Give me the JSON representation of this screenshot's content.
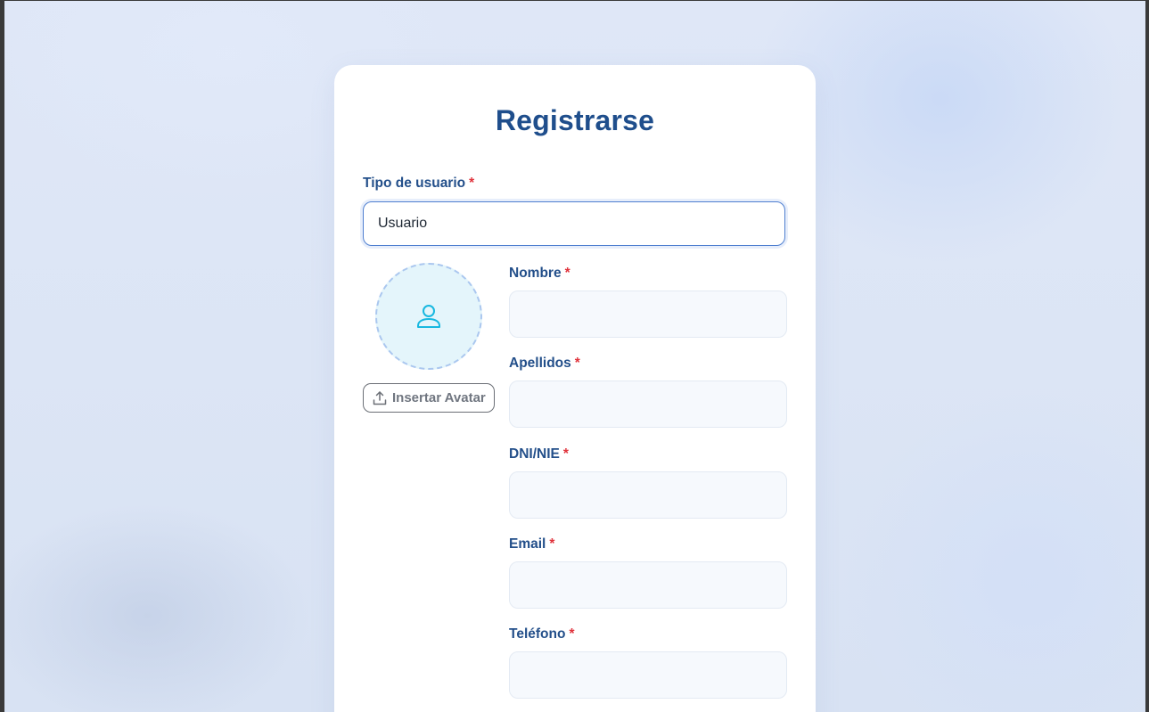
{
  "form": {
    "title": "Registrarse",
    "required_mark": "*",
    "user_type": {
      "label": "Tipo de usuario",
      "value": "Usuario"
    },
    "avatar": {
      "button_label": "Insertar Avatar"
    },
    "fields": {
      "nombre": {
        "label": "Nombre",
        "value": ""
      },
      "apellidos": {
        "label": "Apellidos",
        "value": ""
      },
      "dni": {
        "label": "DNI/NIE",
        "value": ""
      },
      "email": {
        "label": "Email",
        "value": ""
      },
      "telefono": {
        "label": "Teléfono",
        "value": ""
      }
    }
  },
  "colors": {
    "accent": "#1f4e8c",
    "required": "#e0333c",
    "avatar_icon": "#18b8e0",
    "focus_border": "#4f7fd0"
  },
  "icons": {
    "avatar": "user-icon",
    "upload": "upload-icon"
  }
}
